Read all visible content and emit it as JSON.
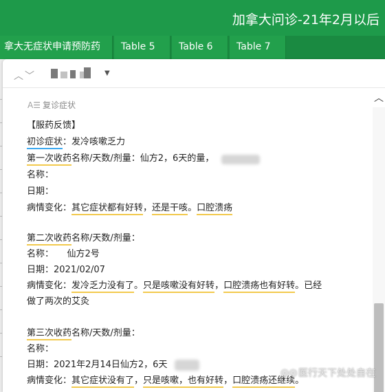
{
  "window": {
    "title": "加拿大问诊-21年2月以后"
  },
  "tabs": [
    {
      "label": "拿大无症状申请预防药"
    },
    {
      "label": "Table 5"
    },
    {
      "label": "Table 6"
    },
    {
      "label": "Table 7"
    }
  ],
  "field": {
    "label": "复诊症状"
  },
  "content": {
    "l1": "【服药反馈】",
    "l2a": "初诊症状",
    "l2b": "：发冷咳嗽乏力",
    "l3a": "第一次收药",
    "l3b": "名称/天数/剂量：仙方2，6天的量，",
    "l4": "名称：",
    "l5": "日期：",
    "l6a": "病情变化：",
    "l6b": "其它症状都有好转",
    "l6c": "，",
    "l6d": "还是干咳",
    "l6e": "。",
    "l6f": "口腔溃疡",
    "l7a": "第二次收药",
    "l7b": "名称/天数/剂量：",
    "l8": "名称：　　仙方2号",
    "l9": "日期：2021/02/07",
    "l10a": "病情变化：",
    "l10b": "发冷乏力没有了",
    "l10c": "。",
    "l10d": "只是咳嗽没有好转",
    "l10e": "，",
    "l10f": "口腔溃疡也有好转",
    "l10g": "。已经",
    "l11": "做了两次的艾灸",
    "l12a": "第三次收药",
    "l12b": "名称/天数/剂量：",
    "l13": "名称：",
    "l14": "日期：2021年2月14日仙方2，6天",
    "l15a": "病情变化：",
    "l15b": "其它症状没有了",
    "l15c": "，",
    "l15d": "只是咳嗽，也有好转",
    "l15e": "，",
    "l15f": "口腔溃疡还继续",
    "l15g": "。"
  },
  "watermark": {
    "text": "医行天下处处自在"
  },
  "colors": {
    "header": "#1e9a4a",
    "highlight_yellow": "#f2c94c",
    "highlight_blue": "#3ba8f0"
  },
  "icons": [
    "chevron-up-icon",
    "chevron-down-icon",
    "dropdown-arrow-icon",
    "text-field-icon",
    "scroll-up-icon",
    "wechat-logo-icon"
  ]
}
